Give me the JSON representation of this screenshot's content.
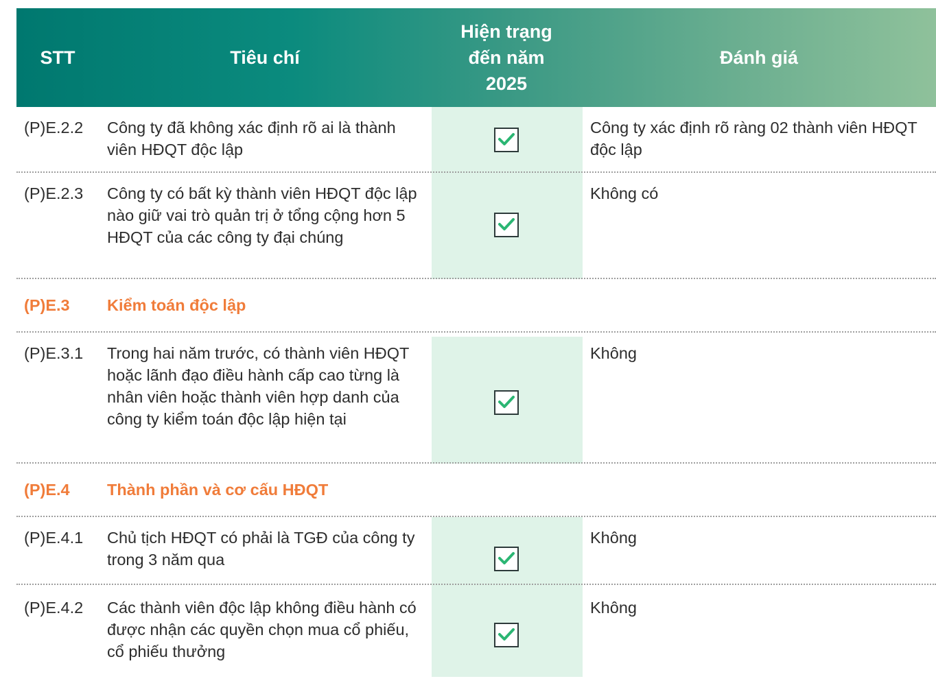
{
  "header": {
    "stt": "STT",
    "criteria": "Tiêu chí",
    "status": "Hiện trạng đến năm 2025",
    "evaluation": "Đánh giá"
  },
  "rows": [
    {
      "id": "(P)E.2.2",
      "criteria": "Công ty đã không xác định rõ ai là thành viên HĐQT độc lập",
      "checked": true,
      "evaluation": "Công ty xác định rõ ràng 02 thành viên HĐQT độc lập"
    },
    {
      "id": "(P)E.2.3",
      "criteria": "Công ty có bất kỳ thành viên HĐQT độc lập nào giữ vai trò quản trị ở tổng cộng hơn 5 HĐQT của các công ty đại chúng",
      "checked": true,
      "evaluation": "Không có"
    },
    {
      "section_id": "(P)E.3",
      "section_title": "Kiểm toán độc lập"
    },
    {
      "id": "(P)E.3.1",
      "criteria": "Trong hai năm trước, có thành viên HĐQT hoặc lãnh đạo điều hành cấp cao từng là nhân viên hoặc thành viên hợp danh của công ty kiểm toán độc lập hiện tại",
      "checked": true,
      "evaluation": "Không"
    },
    {
      "section_id": "(P)E.4",
      "section_title": "Thành phần và cơ cấu HĐQT"
    },
    {
      "id": "(P)E.4.1",
      "criteria": "Chủ tịch HĐQT có phải là TGĐ của công ty trong 3 năm qua",
      "checked": true,
      "evaluation": "Không"
    },
    {
      "id": "(P)E.4.2",
      "criteria": "Các thành viên độc lập không điều hành có được nhận các quyền chọn mua cổ phiếu, cổ phiếu thưởng",
      "checked": true,
      "evaluation": "Không"
    }
  ],
  "colors": {
    "section_accent": "#f07c3a",
    "check_green": "#2bb673",
    "status_bg": "#dff3e8"
  }
}
